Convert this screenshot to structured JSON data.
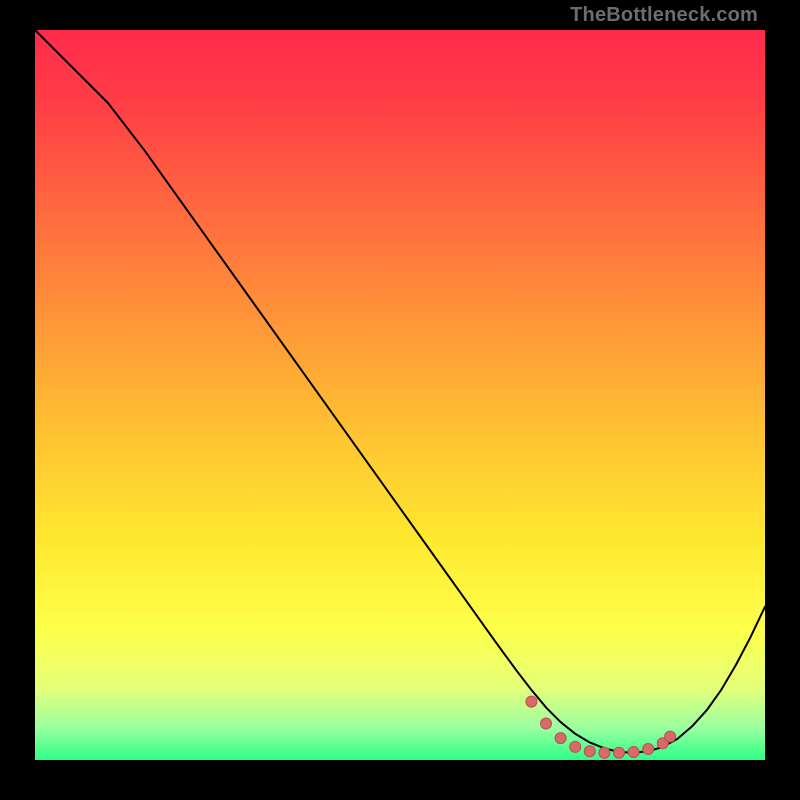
{
  "watermark": "TheBottleneck.com",
  "colors": {
    "curve_stroke": "#000000",
    "marker_fill": "#d96a6a",
    "marker_stroke": "#b94f4f",
    "gradient_top": "#ff2a4b",
    "gradient_bottom": "#2dff87"
  },
  "chart_data": {
    "type": "line",
    "title": "",
    "xlabel": "",
    "ylabel": "",
    "xlim": [
      0,
      100
    ],
    "ylim": [
      0,
      100
    ],
    "grid": false,
    "legend": false,
    "series": [
      {
        "name": "bottleneck-curve",
        "x": [
          0,
          3,
          6,
          10,
          15,
          20,
          25,
          30,
          35,
          40,
          45,
          50,
          55,
          60,
          63,
          66,
          68,
          70,
          72,
          74,
          76,
          78,
          80,
          82,
          84,
          86,
          88,
          90,
          92,
          94,
          96,
          98,
          100
        ],
        "y": [
          100,
          97,
          94,
          90,
          83.5,
          76.5,
          69.5,
          62.5,
          55.5,
          48.5,
          41.5,
          34.5,
          27.5,
          20.5,
          16.3,
          12.2,
          9.6,
          7.2,
          5.2,
          3.6,
          2.4,
          1.6,
          1.1,
          1.0,
          1.2,
          1.8,
          2.9,
          4.6,
          6.8,
          9.6,
          13.0,
          16.8,
          21.0
        ]
      }
    ],
    "markers": {
      "name": "flat-minimum-markers",
      "x": [
        68,
        70,
        72,
        74,
        76,
        78,
        80,
        82,
        84,
        86,
        87
      ],
      "y": [
        8.0,
        5.0,
        3.0,
        1.8,
        1.2,
        1.0,
        1.0,
        1.1,
        1.5,
        2.3,
        3.2
      ]
    }
  }
}
